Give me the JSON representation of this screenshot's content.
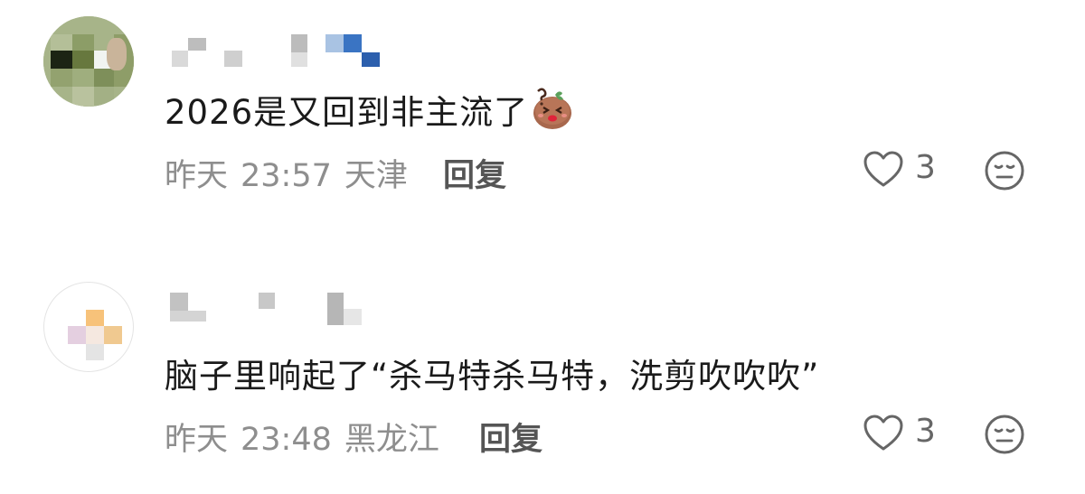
{
  "comments": [
    {
      "text": "2026是又回到非主流了",
      "sticker_icon": "smiling-potato-sticker",
      "date": "昨天",
      "time": "23:57",
      "location": "天津",
      "reply_label": "回复",
      "like_count": "3"
    },
    {
      "text": "脑子里响起了“杀马特杀马特，洗剪吹吹吹”",
      "date": "昨天",
      "time": "23:48",
      "location": "黑龙江",
      "reply_label": "回复",
      "like_count": "3"
    }
  ],
  "icons": {
    "like": "heart-outline-icon",
    "dislike": "neutral-face-icon"
  },
  "colors": {
    "text": "#1a1a1a",
    "meta": "#8e8e8e",
    "icon": "#666666"
  }
}
